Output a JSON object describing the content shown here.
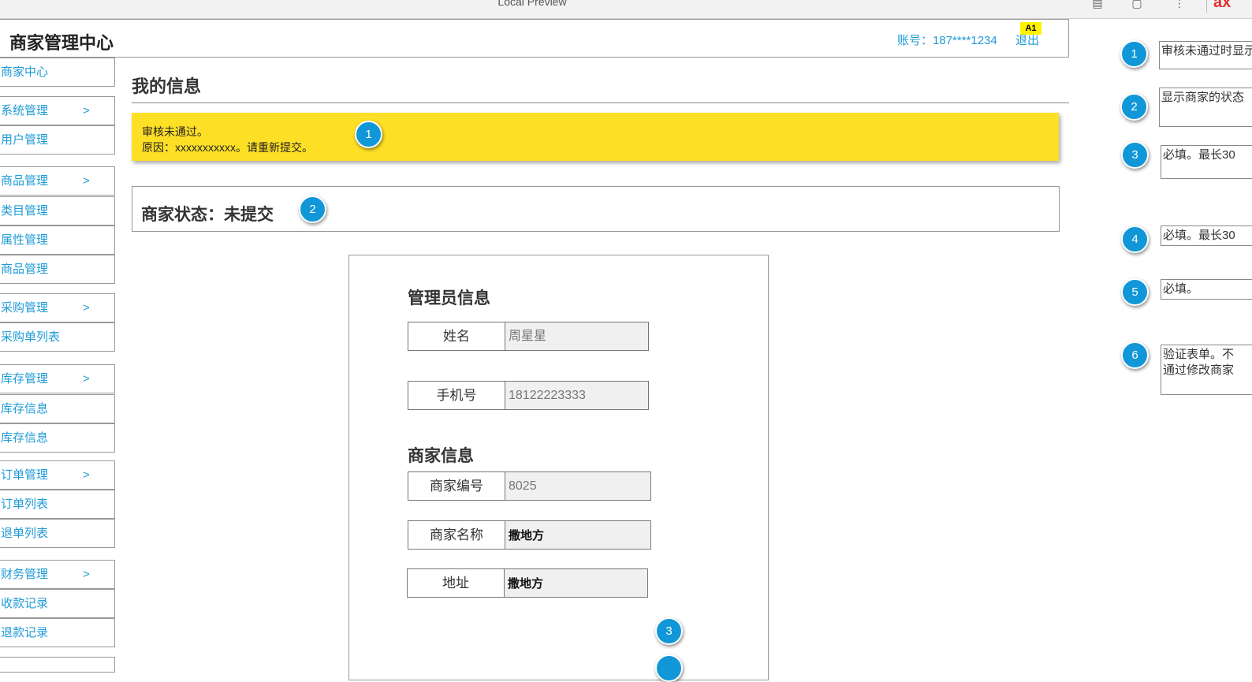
{
  "browser": {
    "title": "Local Preview",
    "logo": "ax"
  },
  "header": {
    "app_title": "商家管理中心",
    "account": "账号：187****1234",
    "logout": "退出",
    "badge": "A1"
  },
  "sidebar": {
    "items": [
      {
        "label": "商家中心",
        "chevron": ""
      },
      {
        "label": "系统管理",
        "chevron": ">"
      },
      {
        "label": "用户管理",
        "chevron": ""
      },
      {
        "label": "商品管理",
        "chevron": ">"
      },
      {
        "label": "类目管理",
        "chevron": ""
      },
      {
        "label": "属性管理",
        "chevron": ""
      },
      {
        "label": "商品管理",
        "chevron": ""
      },
      {
        "label": "采购管理",
        "chevron": ">"
      },
      {
        "label": "采购单列表",
        "chevron": ""
      },
      {
        "label": "库存管理",
        "chevron": ">"
      },
      {
        "label": "库存信息",
        "chevron": ""
      },
      {
        "label": "库存信息",
        "chevron": ""
      },
      {
        "label": "订单管理",
        "chevron": ">"
      },
      {
        "label": "订单列表",
        "chevron": ""
      },
      {
        "label": "退单列表",
        "chevron": ""
      },
      {
        "label": "财务管理",
        "chevron": ">"
      },
      {
        "label": "收款记录",
        "chevron": ""
      },
      {
        "label": "退款记录",
        "chevron": ""
      }
    ]
  },
  "main": {
    "page_title": "我的信息",
    "alert": {
      "line1": "审核未通过。",
      "line2": "原因：xxxxxxxxxxx。请重新提交。"
    },
    "status": "商家状态：未提交",
    "admin_section": {
      "title": "管理员信息",
      "fields": [
        {
          "label": "姓名",
          "placeholder": "周星星",
          "value": ""
        },
        {
          "label": "手机号",
          "placeholder": "18122223333",
          "value": ""
        }
      ]
    },
    "merchant_section": {
      "title": "商家信息",
      "fields": [
        {
          "label": "商家编号",
          "placeholder": "8025",
          "value": ""
        },
        {
          "label": "商家名称",
          "placeholder": "",
          "value": "撒地方"
        },
        {
          "label": "地址",
          "placeholder": "",
          "value": "撒地方"
        }
      ]
    }
  },
  "markers": [
    "1",
    "2",
    "3"
  ],
  "notes": [
    {
      "marker": "1",
      "text": "审核未通过时显示"
    },
    {
      "marker": "2",
      "text": "显示商家的状态"
    },
    {
      "marker": "3",
      "text": "必填。最长30"
    },
    {
      "marker": "4",
      "text": "必填。最长30"
    },
    {
      "marker": "5",
      "text": "必填。"
    },
    {
      "marker": "6",
      "line1": "验证表单。不",
      "line2": "通过修改商家"
    }
  ],
  "colors": {
    "accent": "#1e9ad6",
    "alert_bg": "#fddf26",
    "marker": "#1197d8",
    "badge": "#fff200"
  }
}
